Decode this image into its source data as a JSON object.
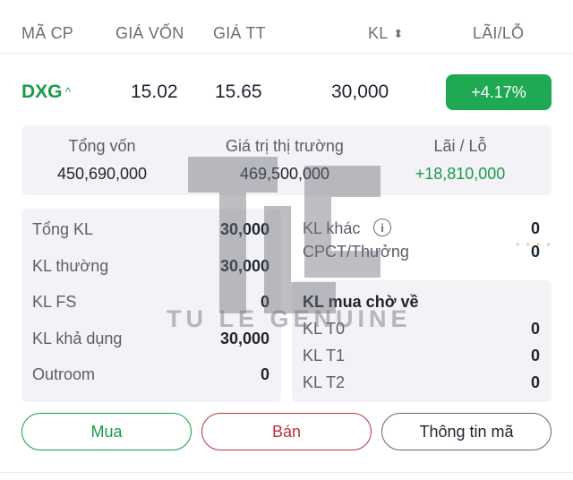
{
  "header": {
    "col_ticker": "MÃ CP",
    "col_cost": "GIÁ VỐN",
    "col_market": "GIÁ TT",
    "col_volume": "KL",
    "col_pl": "LÃI/LỖ",
    "sort_icon": "sort-icon"
  },
  "holding": {
    "ticker": "DXG",
    "cost_price": "15.02",
    "market_price": "15.65",
    "volume": "30,000",
    "pl_percent": "+4.17%",
    "pl_color": "#1ea952"
  },
  "summary": {
    "total_capital_label": "Tổng vốn",
    "total_capital_value": "450,690,000",
    "market_value_label": "Giá trị thị trường",
    "market_value_value": "469,500,000",
    "pl_label": "Lãi / Lỗ",
    "pl_value": "+18,810,000"
  },
  "details_left": [
    {
      "label": "Tổng KL",
      "value": "30,000"
    },
    {
      "label": "KL thường",
      "value": "30,000"
    },
    {
      "label": "KL FS",
      "value": "0"
    },
    {
      "label": "KL khả dụng",
      "value": "30,000"
    },
    {
      "label": "Outroom",
      "value": "0"
    }
  ],
  "details_right": {
    "other_label": "KL khác",
    "other_value": "0",
    "dividend_label": "CPCT/Thưởng",
    "dividend_value": "0",
    "pending_title": "KL mua chờ về",
    "pending": [
      {
        "label": "KL T0",
        "value": "0"
      },
      {
        "label": "KL T1",
        "value": "0"
      },
      {
        "label": "KL T2",
        "value": "0"
      }
    ]
  },
  "actions": {
    "buy": "Mua",
    "sell": "Bán",
    "info": "Thông tin mã"
  },
  "watermark": {
    "text": "TU LE GENUINE"
  }
}
